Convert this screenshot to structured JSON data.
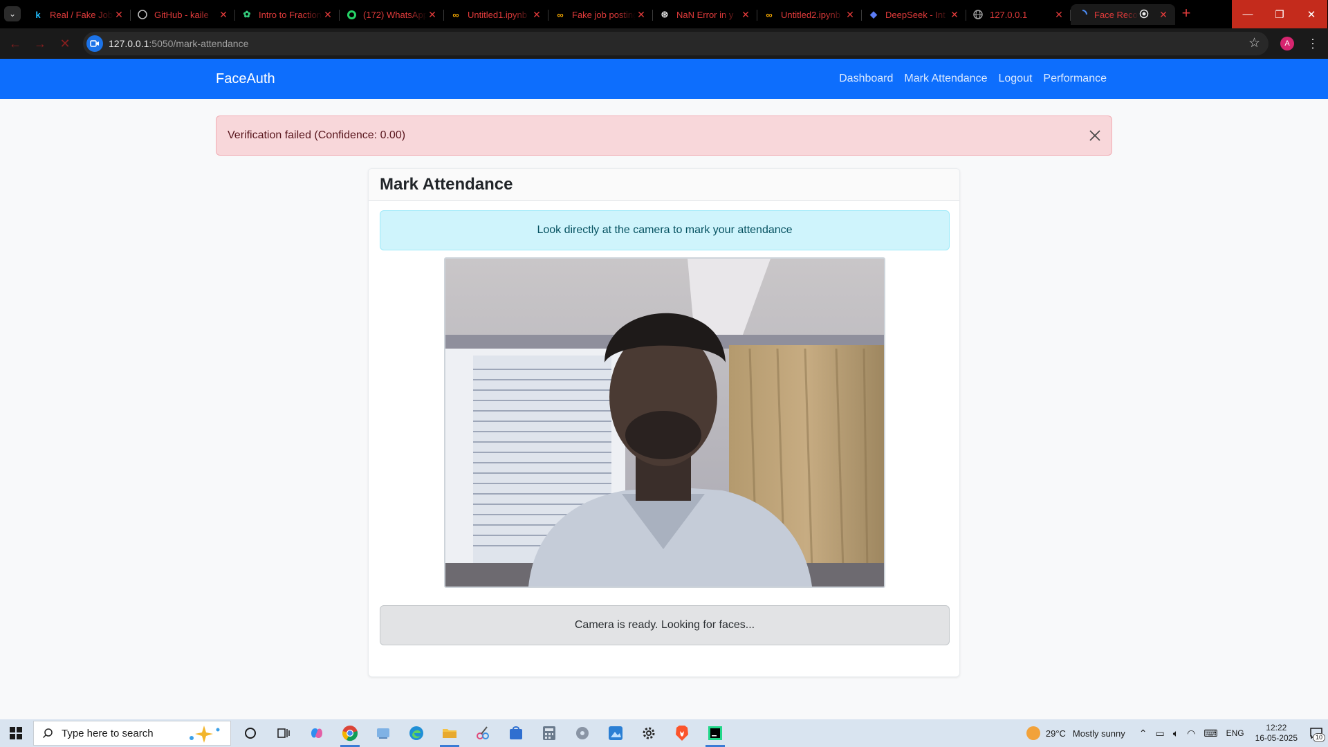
{
  "browser": {
    "tabs": [
      {
        "title": "Real / Fake Job",
        "icon": "kaggle-icon",
        "active": false
      },
      {
        "title": "GitHub - kaile",
        "icon": "github-icon",
        "active": false
      },
      {
        "title": "Intro to Fraction",
        "icon": "fraction-icon",
        "active": false
      },
      {
        "title": "(172) WhatsApp",
        "icon": "whatsapp-icon",
        "active": false
      },
      {
        "title": "Untitled1.ipynb",
        "icon": "colab-icon",
        "active": false
      },
      {
        "title": "Fake job posting",
        "icon": "colab-icon",
        "active": false
      },
      {
        "title": "NaN Error in y",
        "icon": "openai-icon",
        "active": false
      },
      {
        "title": "Untitled2.ipynb",
        "icon": "colab-icon",
        "active": false
      },
      {
        "title": "DeepSeek - Int",
        "icon": "deepseek-icon",
        "active": false
      },
      {
        "title": "127.0.0.1",
        "icon": "globe-icon",
        "active": false
      },
      {
        "title": "Face Recog",
        "icon": "loading-icon",
        "active": true
      }
    ],
    "url_host": "127.0.0.1",
    "url_path": ":5050/mark-attendance",
    "profile_initial": "A"
  },
  "navbar": {
    "brand": "FaceAuth",
    "links": [
      "Dashboard",
      "Mark Attendance",
      "Logout",
      "Performance"
    ]
  },
  "alert": {
    "message": "Verification failed (Confidence: 0.00)"
  },
  "card": {
    "title": "Mark Attendance",
    "instruction": "Look directly at the camera to mark your attendance",
    "status": "Camera is ready. Looking for faces..."
  },
  "taskbar": {
    "search_placeholder": "Type here to search",
    "weather_temp": "29°C",
    "weather_desc": "Mostly sunny",
    "language": "ENG",
    "time": "12:22",
    "date": "16-05-2025",
    "notification_count": "10"
  },
  "colors": {
    "navbar": "#0d6efd",
    "danger_bg": "#f8d7da",
    "info_bg": "#cff4fc",
    "status_bg": "#e2e3e5",
    "tab_text": "#e23b3b"
  }
}
